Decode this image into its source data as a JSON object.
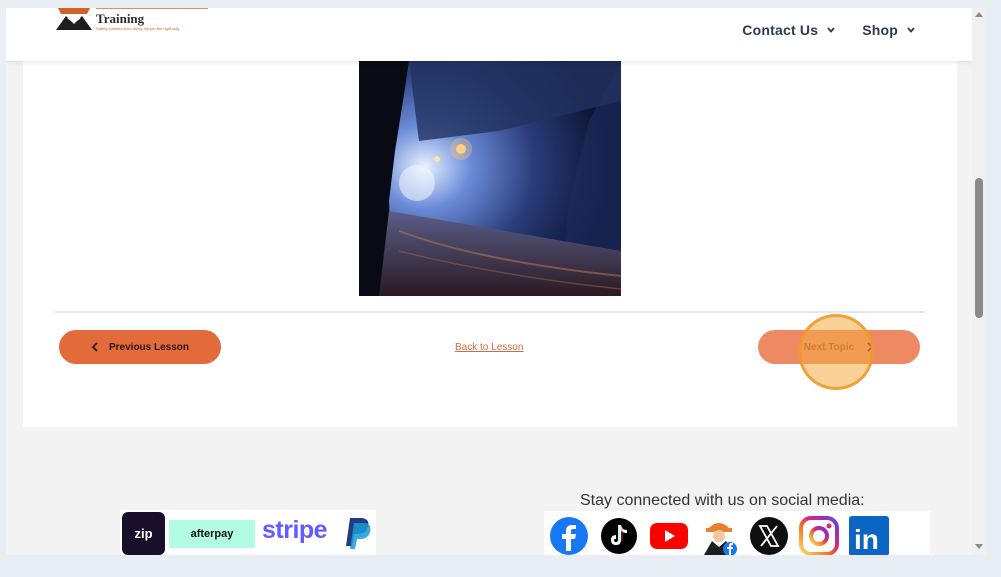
{
  "header": {
    "logo_text": "Training",
    "logo_tagline": "Safety courses from doing the job the right way",
    "nav": [
      {
        "label": "Contact Us"
      },
      {
        "label": "Shop"
      }
    ]
  },
  "lesson": {
    "image_alt": "Underground mine tunnel with lights",
    "prev_label": "Previous Lesson",
    "back_label": "Back to Lesson",
    "next_label": "Next Topic"
  },
  "footer": {
    "social_title": "Stay connected with us on social media:",
    "payments": {
      "zip": "zip",
      "afterpay": "afterpay",
      "stripe": "stripe"
    },
    "socials": [
      "facebook",
      "tiktok",
      "youtube",
      "safety-mascot",
      "x",
      "instagram",
      "linkedin"
    ],
    "linkedin_text": "in"
  },
  "colors": {
    "accent": "#e36a3a",
    "accent_light": "#ee8a63",
    "click_highlight": "#f5aa46"
  }
}
